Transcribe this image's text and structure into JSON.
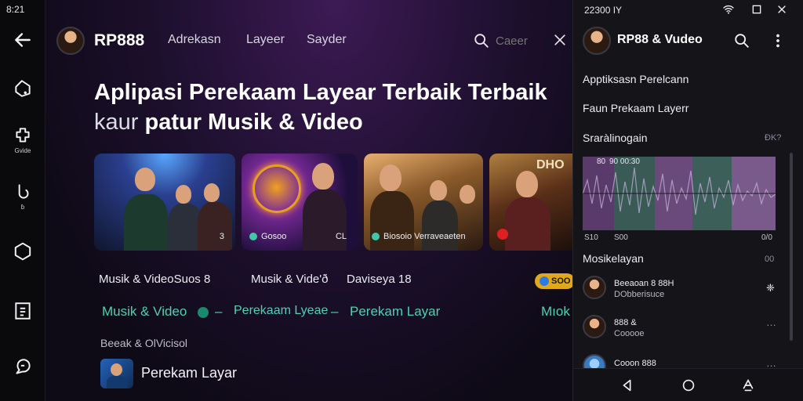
{
  "rail": {
    "clock": "8:21",
    "items": [
      {
        "icon": "back-arrow-icon",
        "label": ""
      },
      {
        "icon": "tag-icon",
        "label": ""
      },
      {
        "icon": "puzzle-icon",
        "label": "Gvide"
      },
      {
        "icon": "refresh-icon",
        "label": "ɓ"
      },
      {
        "icon": "hexagon-icon",
        "label": ""
      },
      {
        "icon": "document-icon",
        "label": ""
      },
      {
        "icon": "feedback-icon",
        "label": ""
      }
    ]
  },
  "header": {
    "brand": "RP888",
    "nav": [
      "Adrekasn",
      "Layeer",
      "Sayder"
    ],
    "search_placeholder": "Caeer"
  },
  "hero": {
    "line1": "Aplipasi Perekaam Layear Terbaik Terbaik",
    "line2_light": "kaur",
    "line2_bold": "patur Musik & Video"
  },
  "cards": [
    {
      "name": "card-concert",
      "tag": "",
      "num": "3"
    },
    {
      "name": "card-neon",
      "tag": "Gosoo",
      "num": "CL"
    },
    {
      "name": "card-guitar-group",
      "tag": "Biosoio Verraveaeten",
      "num": ""
    },
    {
      "name": "card-red-guitar",
      "tag": "",
      "num": "DHO"
    }
  ],
  "filters_row": {
    "items": [
      "Musik & VideoSuos 8",
      "Musik & Vide'ð",
      "Daviseya 18"
    ],
    "pill": "SOO"
  },
  "tabs_row": {
    "items": [
      "Musik & Video",
      "Perekaam Lyeae",
      "Perekam Layar",
      "Mıok"
    ],
    "separator": "–"
  },
  "section": {
    "heading": "Beeak & OlVicisol",
    "item_label": "Perekam Layar"
  },
  "panel": {
    "status_time": "22300 IY",
    "title": "RP88 & Vudeo",
    "menu": [
      "Apptiksasn Perelcann",
      "Faun Prekaam Layerr"
    ],
    "editor_label": "Sraràlinogain",
    "editor_side": "ÐK?",
    "wave_top_labels": [
      "80",
      "90 00:30"
    ],
    "wave_bottom_labels": [
      "S10",
      "S00",
      "0/0"
    ],
    "music_label": "Mosikelayan",
    "music_side": "00",
    "list": [
      {
        "title": "Beeaoan 8 88H",
        "sub": "DObberisuce",
        "action": "❈"
      },
      {
        "title": "888 &",
        "sub": "Cooooe",
        "action": "…"
      },
      {
        "title": "Cooon 888",
        "sub": "",
        "action": "…"
      }
    ]
  },
  "colors": {
    "accent_teal": "#4fd0b4",
    "accent_purple": "#9a56b0",
    "accent_yellow": "#e0a81a",
    "panel_bg": "#151419"
  }
}
